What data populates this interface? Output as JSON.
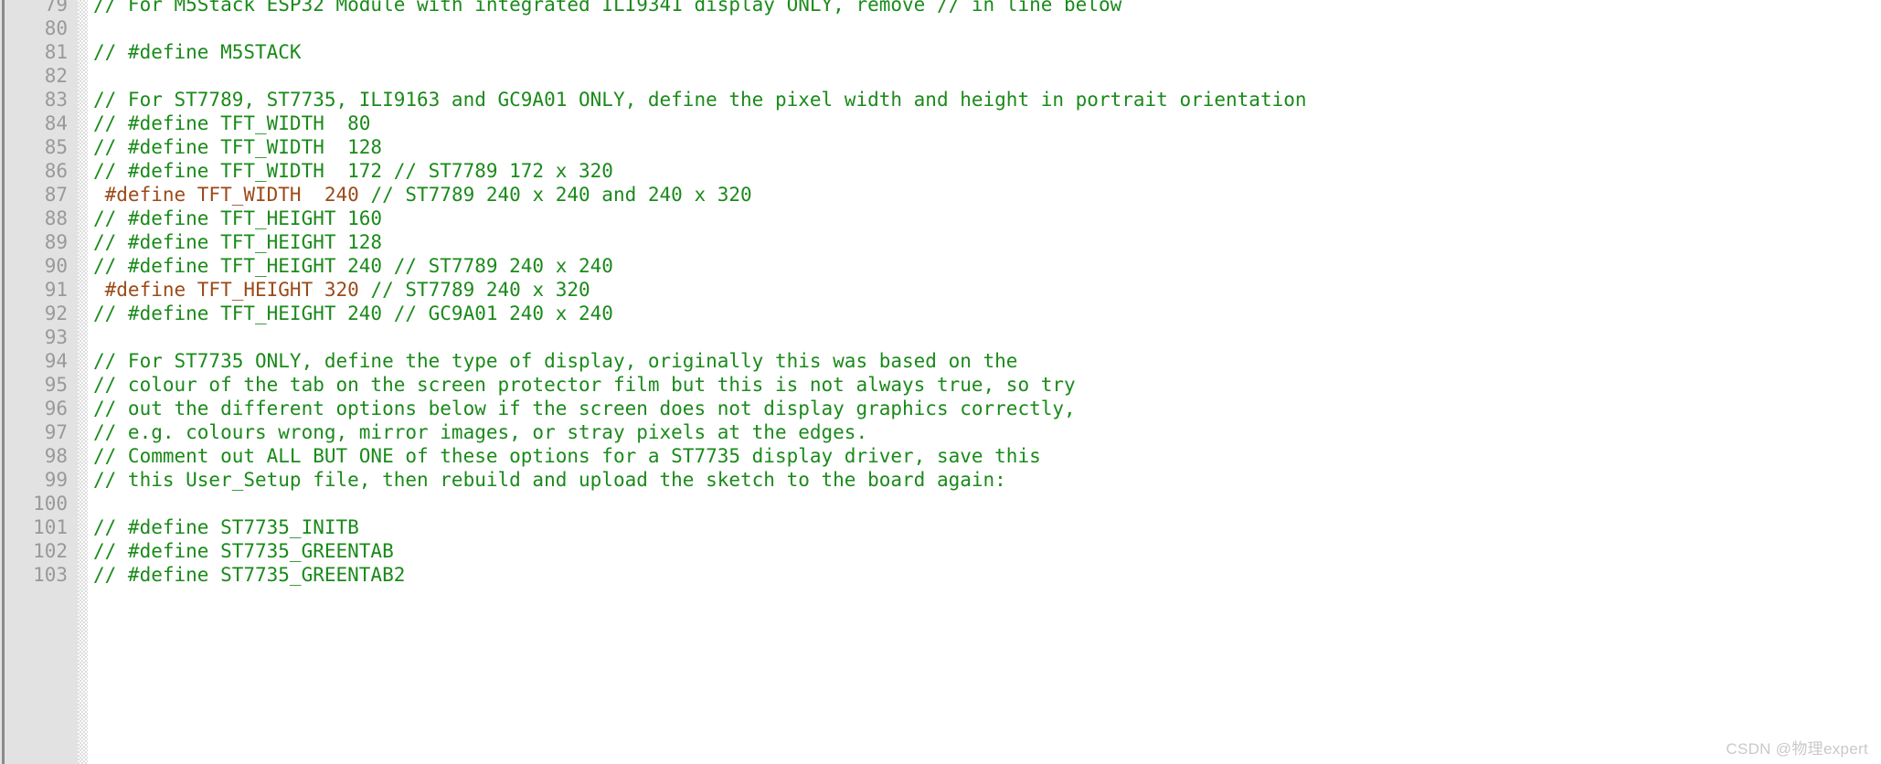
{
  "editor": {
    "kind": "code-editor-viewport",
    "language": "cpp",
    "first_visible_line": 79,
    "last_visible_line": 103,
    "colors": {
      "background": "#ffffff",
      "gutter_background": "#e2e2e2",
      "line_number": "#999999",
      "comment_green": "#1a8a1a",
      "preprocessor_orange": "#9b4a18"
    }
  },
  "watermark": {
    "text": "CSDN @物理expert"
  },
  "lines": [
    {
      "number": "79",
      "tokens": [
        {
          "cls": "tok-comment",
          "text": "// For M5Stack ESP32 Module with integrated ILI9341 display ONLY, remove // in line below"
        }
      ]
    },
    {
      "number": "80",
      "tokens": []
    },
    {
      "number": "81",
      "tokens": [
        {
          "cls": "tok-comment",
          "text": "// #define M5STACK"
        }
      ]
    },
    {
      "number": "82",
      "tokens": []
    },
    {
      "number": "83",
      "tokens": [
        {
          "cls": "tok-comment",
          "text": "// For ST7789, ST7735, ILI9163 and GC9A01 ONLY, define the pixel width and height in portrait orientation"
        }
      ]
    },
    {
      "number": "84",
      "tokens": [
        {
          "cls": "tok-comment",
          "text": "// #define TFT_WIDTH  80"
        }
      ]
    },
    {
      "number": "85",
      "tokens": [
        {
          "cls": "tok-comment",
          "text": "// #define TFT_WIDTH  128"
        }
      ]
    },
    {
      "number": "86",
      "tokens": [
        {
          "cls": "tok-comment",
          "text": "// #define TFT_WIDTH  172 // ST7789 172 x 320"
        }
      ]
    },
    {
      "number": "87",
      "tokens": [
        {
          "cls": "tok-pp",
          "text": " #define TFT_WIDTH  240 "
        },
        {
          "cls": "tok-comment",
          "text": "// ST7789 240 x 240 and 240 x 320"
        }
      ]
    },
    {
      "number": "88",
      "tokens": [
        {
          "cls": "tok-comment",
          "text": "// #define TFT_HEIGHT 160"
        }
      ]
    },
    {
      "number": "89",
      "tokens": [
        {
          "cls": "tok-comment",
          "text": "// #define TFT_HEIGHT 128"
        }
      ]
    },
    {
      "number": "90",
      "tokens": [
        {
          "cls": "tok-comment",
          "text": "// #define TFT_HEIGHT 240 // ST7789 240 x 240"
        }
      ]
    },
    {
      "number": "91",
      "tokens": [
        {
          "cls": "tok-pp",
          "text": " #define TFT_HEIGHT 320 "
        },
        {
          "cls": "tok-comment",
          "text": "// ST7789 240 x 320"
        }
      ]
    },
    {
      "number": "92",
      "tokens": [
        {
          "cls": "tok-comment",
          "text": "// #define TFT_HEIGHT 240 // GC9A01 240 x 240"
        }
      ]
    },
    {
      "number": "93",
      "tokens": []
    },
    {
      "number": "94",
      "tokens": [
        {
          "cls": "tok-comment",
          "text": "// For ST7735 ONLY, define the type of display, originally this was based on the"
        }
      ]
    },
    {
      "number": "95",
      "tokens": [
        {
          "cls": "tok-comment",
          "text": "// colour of the tab on the screen protector film but this is not always true, so try"
        }
      ]
    },
    {
      "number": "96",
      "tokens": [
        {
          "cls": "tok-comment",
          "text": "// out the different options below if the screen does not display graphics correctly,"
        }
      ]
    },
    {
      "number": "97",
      "tokens": [
        {
          "cls": "tok-comment",
          "text": "// e.g. colours wrong, mirror images, or stray pixels at the edges."
        }
      ]
    },
    {
      "number": "98",
      "tokens": [
        {
          "cls": "tok-comment",
          "text": "// Comment out ALL BUT ONE of these options for a ST7735 display driver, save this"
        }
      ]
    },
    {
      "number": "99",
      "tokens": [
        {
          "cls": "tok-comment",
          "text": "// this User_Setup file, then rebuild and upload the sketch to the board again:"
        }
      ]
    },
    {
      "number": "100",
      "tokens": []
    },
    {
      "number": "101",
      "tokens": [
        {
          "cls": "tok-comment",
          "text": "// #define ST7735_INITB"
        }
      ]
    },
    {
      "number": "102",
      "tokens": [
        {
          "cls": "tok-comment",
          "text": "// #define ST7735_GREENTAB"
        }
      ]
    },
    {
      "number": "103",
      "tokens": [
        {
          "cls": "tok-comment",
          "text": "// #define ST7735_GREENTAB2"
        }
      ]
    }
  ]
}
